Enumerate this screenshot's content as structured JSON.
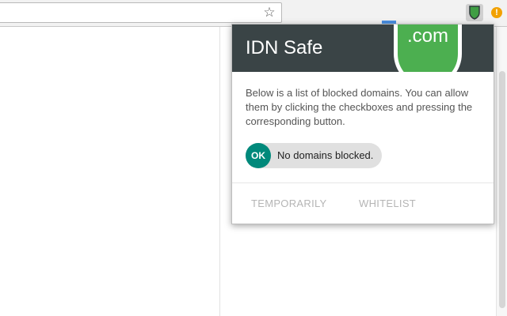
{
  "toolbar": {
    "bookmark_icon": "star-icon",
    "extension_icon": "idn-safe-shield-icon",
    "warning_icon": "warning-icon",
    "warning_glyph": "!"
  },
  "popup": {
    "title": "IDN Safe",
    "logo_text": ".com",
    "description": "Below is a list of blocked domains. You can allow them by clicking the checkboxes and pressing the corresponding button.",
    "status": {
      "badge": "OK",
      "message": "No domains blocked."
    },
    "buttons": {
      "temporarily": "TEMPORARILY",
      "whitelist": "WHITELIST"
    }
  },
  "colors": {
    "header_bg": "#3a4446",
    "logo_green": "#4caf50",
    "ok_badge": "#00897b",
    "warning": "#f2a100"
  }
}
